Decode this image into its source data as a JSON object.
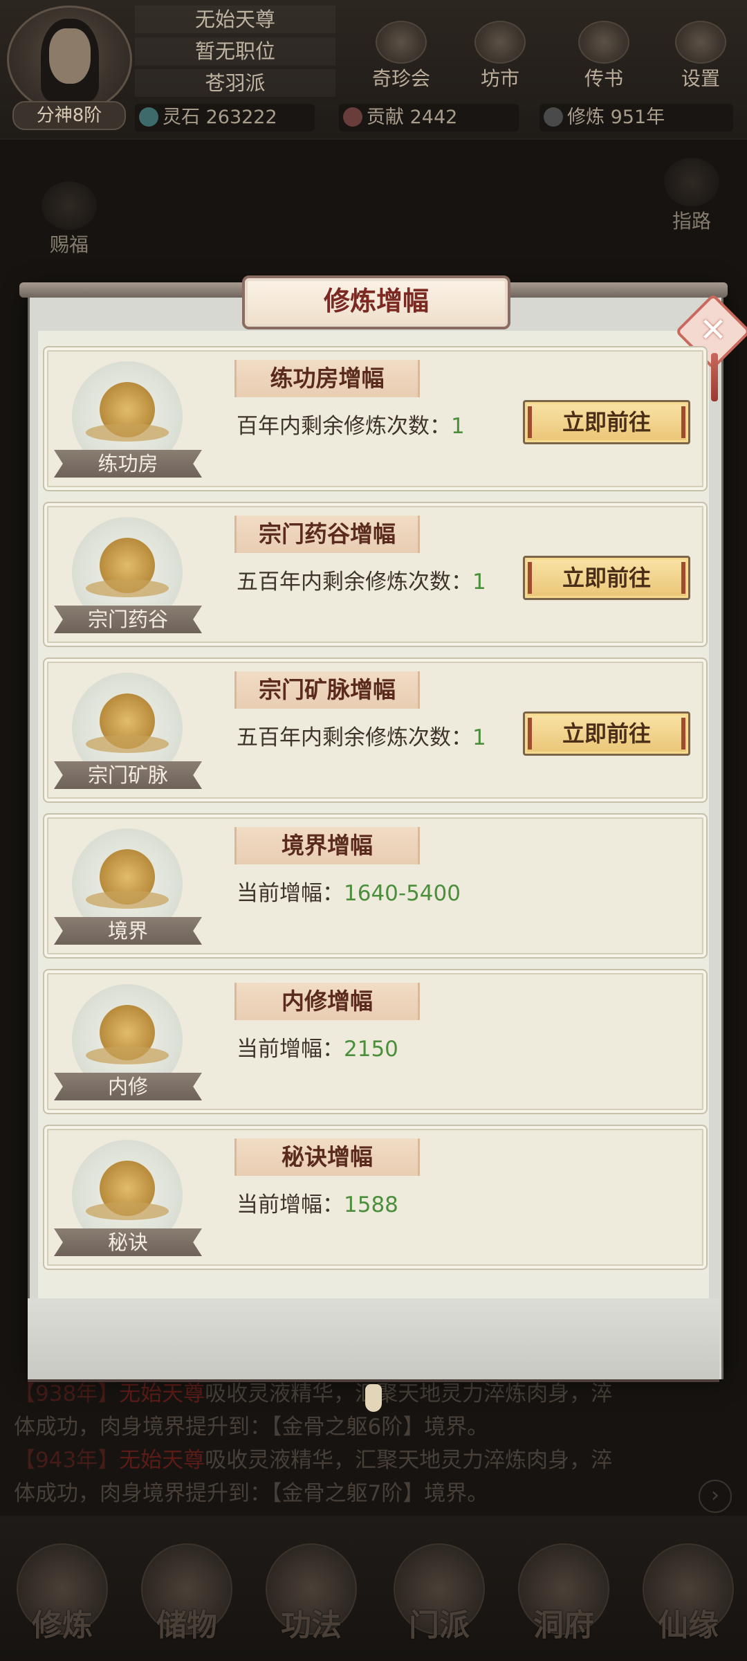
{
  "player": {
    "name": "无始天尊",
    "position": "暂无职位",
    "sect": "苍羽派",
    "rank": "分神8阶"
  },
  "resources": {
    "spirit_stone": "灵石 263222",
    "contribution": "贡献 2442",
    "cultivation": "修炼 951年"
  },
  "top_menu": [
    "奇珍会",
    "坊市",
    "传书",
    "设置"
  ],
  "side_left": "赐福",
  "side_right": "指路",
  "modal": {
    "title": "修炼增幅",
    "cards": [
      {
        "emblem": "练功房",
        "title": "练功房增幅",
        "desc_label": "百年内剩余修炼次数：",
        "value": "1",
        "button": "立即前往"
      },
      {
        "emblem": "宗门药谷",
        "title": "宗门药谷增幅",
        "desc_label": "五百年内剩余修炼次数：",
        "value": "1",
        "button": "立即前往"
      },
      {
        "emblem": "宗门矿脉",
        "title": "宗门矿脉增幅",
        "desc_label": "五百年内剩余修炼次数：",
        "value": "1",
        "button": "立即前往"
      },
      {
        "emblem": "境界",
        "title": "境界增幅",
        "desc_label": "当前增幅：",
        "value": "1640-5400"
      },
      {
        "emblem": "内修",
        "title": "内修增幅",
        "desc_label": "当前增幅：",
        "value": "2150"
      },
      {
        "emblem": "秘诀",
        "title": "秘诀增幅",
        "desc_label": "当前增幅：",
        "value": "1588"
      }
    ]
  },
  "log": [
    {
      "year": "【938年】",
      "name": "无始天尊",
      "text1": "吸收灵液精华，汇聚天地灵力淬炼肉身，淬",
      "text2": "体成功，肉身境界提升到：【金骨之躯6阶】境界。"
    },
    {
      "year": "【943年】",
      "name": "无始天尊",
      "text1": "吸收灵液精华，汇聚天地灵力淬炼肉身，淬",
      "text2": "体成功，肉身境界提升到：【金骨之躯7阶】境界。"
    }
  ],
  "bottom_nav": [
    "修炼",
    "储物",
    "功法",
    "门派",
    "洞府",
    "仙缘"
  ],
  "colors": {
    "title_red": "#7a2a22",
    "value_green": "#4b8f3c",
    "button_gold": "#eac576"
  }
}
